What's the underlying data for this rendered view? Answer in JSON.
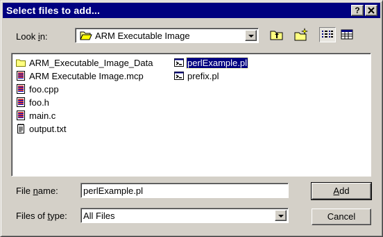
{
  "dialog": {
    "title": "Select files to add...",
    "help_label": "?",
    "close_label": "✕"
  },
  "look_in": {
    "label_pre": "Look ",
    "label_accel": "i",
    "label_post": "n:",
    "value": "ARM Executable Image"
  },
  "toolbar": {
    "icons": [
      "up-one-level-icon",
      "create-new-folder-icon",
      "list-view-icon",
      "details-view-icon"
    ]
  },
  "files": [
    {
      "name": "ARM_Executable_Image_Data",
      "icon": "folder-icon"
    },
    {
      "name": "ARM Executable Image.mcp",
      "icon": "project-file-icon"
    },
    {
      "name": "foo.cpp",
      "icon": "source-file-icon"
    },
    {
      "name": "foo.h",
      "icon": "source-file-icon"
    },
    {
      "name": "main.c",
      "icon": "source-file-icon"
    },
    {
      "name": "output.txt",
      "icon": "text-file-icon"
    },
    {
      "name": "perlExample.pl",
      "icon": "perl-script-icon",
      "selected": true
    },
    {
      "name": "prefix.pl",
      "icon": "perl-script-icon"
    }
  ],
  "file_name": {
    "label_pre": "File ",
    "label_accel": "n",
    "label_post": "ame:",
    "value": "perlExample.pl"
  },
  "file_type": {
    "label_pre": "Files of ",
    "label_accel": "t",
    "label_post": "ype:",
    "value": "All Files"
  },
  "buttons": {
    "add_accel": "A",
    "add_rest": "dd",
    "cancel": "Cancel"
  },
  "colors": {
    "titlebar": "#000080",
    "face": "#d4d0c8",
    "selection": "#000080"
  }
}
